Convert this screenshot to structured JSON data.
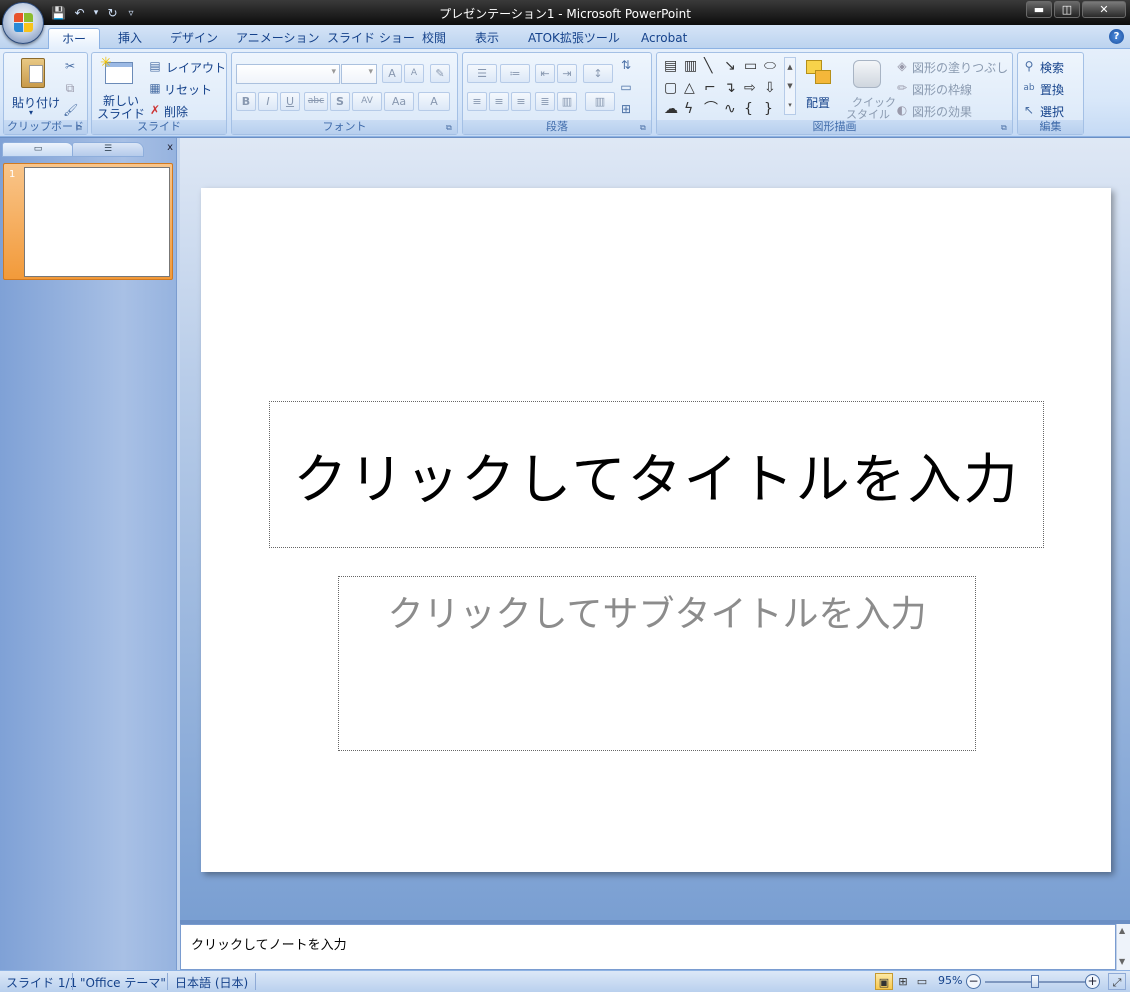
{
  "window": {
    "title": "プレゼンテーション1 - Microsoft PowerPoint",
    "minimize": "▬",
    "maximize": "◫",
    "close": "✕"
  },
  "qat": {
    "save": "💾",
    "undo": "↶",
    "undo_dd": "▾",
    "redo": "↻",
    "customize": "▿"
  },
  "tabs": [
    {
      "label": "ホーム",
      "active": true
    },
    {
      "label": "挿入"
    },
    {
      "label": "デザイン"
    },
    {
      "label": "アニメーション"
    },
    {
      "label": "スライド ショー"
    },
    {
      "label": "校閲"
    },
    {
      "label": "表示"
    },
    {
      "label": "ATOK拡張ツール"
    },
    {
      "label": "Acrobat"
    }
  ],
  "help": "?",
  "ribbon": {
    "clipboard": {
      "paste": "貼り付け",
      "label": "クリップボード"
    },
    "slides": {
      "new_slide_line1": "新しい",
      "new_slide_line2": "スライド",
      "layout": "レイアウト",
      "reset": "リセット",
      "delete": "削除",
      "label": "スライド"
    },
    "font": {
      "label": "フォント",
      "bold": "B",
      "italic": "I",
      "underline": "U",
      "strike": "abc",
      "shadow": "S",
      "spacing": "AV",
      "case": "Aa",
      "color": "A",
      "grow": "A",
      "shrink": "A"
    },
    "paragraph": {
      "label": "段落"
    },
    "drawing": {
      "arrange": "配置",
      "quick_style_line1": "クイック",
      "quick_style_line2": "スタイル",
      "fill": "図形の塗りつぶし",
      "outline": "図形の枠線",
      "effects": "図形の効果",
      "label": "図形描画"
    },
    "editing": {
      "find": "検索",
      "replace": "置換",
      "select": "選択",
      "label": "編集"
    }
  },
  "slide_panel": {
    "slide_number": "1",
    "close": "x"
  },
  "slide": {
    "title_placeholder": "クリックしてタイトルを入力",
    "subtitle_placeholder": "クリックしてサブタイトルを入力"
  },
  "notes": {
    "placeholder": "クリックしてノートを入力"
  },
  "status": {
    "slide": "スライド 1/1",
    "theme": "\"Office テーマ\"",
    "language": "日本語 (日本)",
    "zoom": "95%",
    "zoom_fraction": 0.5
  },
  "colors": {
    "accent": "#f29a3a",
    "ribbon": "#d8e7f9",
    "text": "#15428b"
  }
}
